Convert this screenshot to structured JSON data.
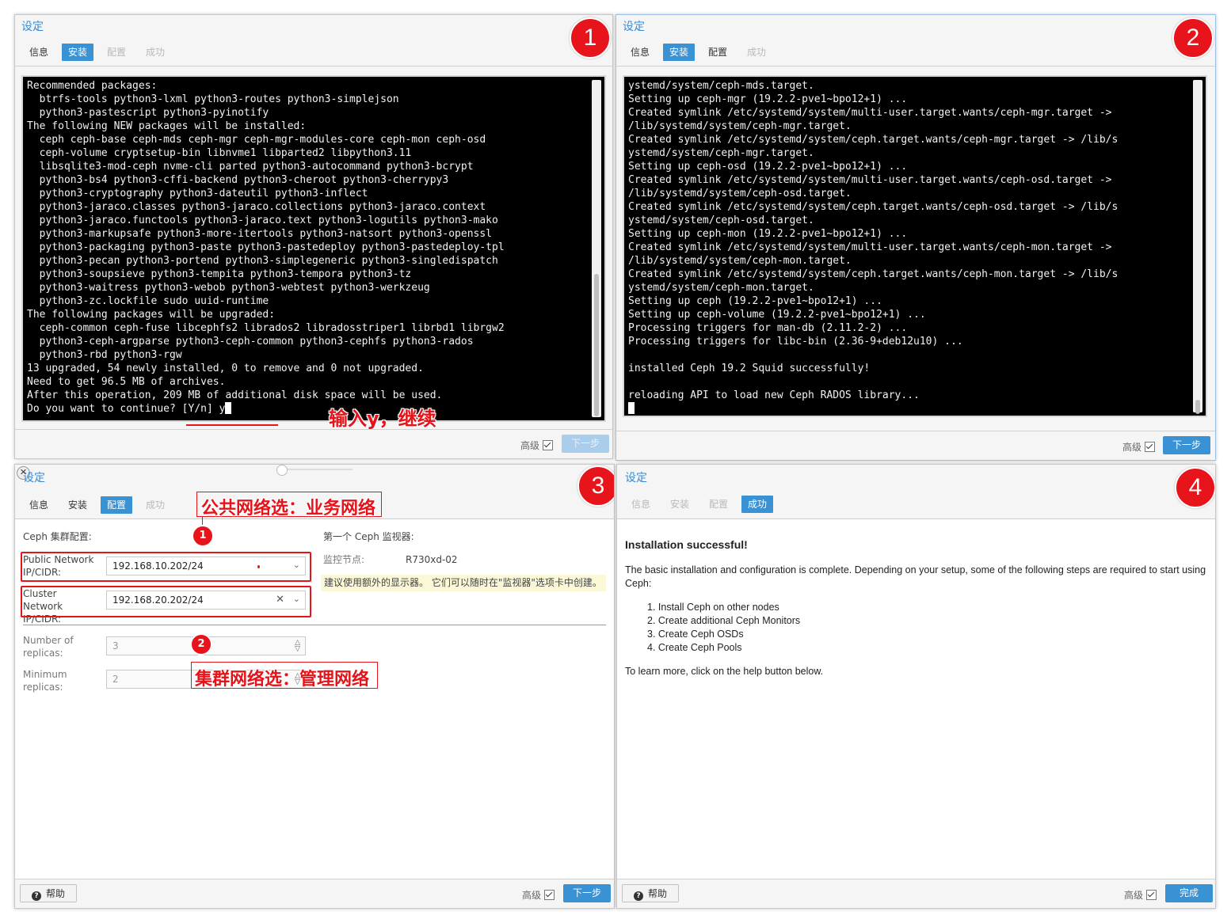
{
  "common": {
    "title": "设定",
    "tabs": [
      "信息",
      "安装",
      "配置",
      "成功"
    ],
    "advanced_label": "高级",
    "next_label": "下一步",
    "finish_label": "完成",
    "help_label": "帮助"
  },
  "badges": [
    "1",
    "2",
    "3",
    "4"
  ],
  "panel1": {
    "terminal_lines": [
      "Recommended packages:",
      "  btrfs-tools python3-lxml python3-routes python3-simplejson",
      "  python3-pastescript python3-pyinotify",
      "The following NEW packages will be installed:",
      "  ceph ceph-base ceph-mds ceph-mgr ceph-mgr-modules-core ceph-mon ceph-osd",
      "  ceph-volume cryptsetup-bin libnvme1 libparted2 libpython3.11",
      "  libsqlite3-mod-ceph nvme-cli parted python3-autocommand python3-bcrypt",
      "  python3-bs4 python3-cffi-backend python3-cheroot python3-cherrypy3",
      "  python3-cryptography python3-dateutil python3-inflect",
      "  python3-jaraco.classes python3-jaraco.collections python3-jaraco.context",
      "  python3-jaraco.functools python3-jaraco.text python3-logutils python3-mako",
      "  python3-markupsafe python3-more-itertools python3-natsort python3-openssl",
      "  python3-packaging python3-paste python3-pastedeploy python3-pastedeploy-tpl",
      "  python3-pecan python3-portend python3-simplegeneric python3-singledispatch",
      "  python3-soupsieve python3-tempita python3-tempora python3-tz",
      "  python3-waitress python3-webob python3-webtest python3-werkzeug",
      "  python3-zc.lockfile sudo uuid-runtime",
      "The following packages will be upgraded:",
      "  ceph-common ceph-fuse libcephfs2 librados2 libradosstriper1 librbd1 librgw2",
      "  python3-ceph-argparse python3-ceph-common python3-cephfs python3-rados",
      "  python3-rbd python3-rgw",
      "13 upgraded, 54 newly installed, 0 to remove and 0 not upgraded.",
      "Need to get 96.5 MB of archives.",
      "After this operation, 209 MB of additional disk space will be used."
    ],
    "prompt": "Do you want to continue? [Y/n] y",
    "annotation": "输入y，继续"
  },
  "panel2": {
    "terminal_lines": [
      "ystemd/system/ceph-mds.target.",
      "Setting up ceph-mgr (19.2.2-pve1~bpo12+1) ...",
      "Created symlink /etc/systemd/system/multi-user.target.wants/ceph-mgr.target ->",
      "/lib/systemd/system/ceph-mgr.target.",
      "Created symlink /etc/systemd/system/ceph.target.wants/ceph-mgr.target -> /lib/s",
      "ystemd/system/ceph-mgr.target.",
      "Setting up ceph-osd (19.2.2-pve1~bpo12+1) ...",
      "Created symlink /etc/systemd/system/multi-user.target.wants/ceph-osd.target ->",
      "/lib/systemd/system/ceph-osd.target.",
      "Created symlink /etc/systemd/system/ceph.target.wants/ceph-osd.target -> /lib/s",
      "ystemd/system/ceph-osd.target.",
      "Setting up ceph-mon (19.2.2-pve1~bpo12+1) ...",
      "Created symlink /etc/systemd/system/multi-user.target.wants/ceph-mon.target ->",
      "/lib/systemd/system/ceph-mon.target.",
      "Created symlink /etc/systemd/system/ceph.target.wants/ceph-mon.target -> /lib/s",
      "ystemd/system/ceph-mon.target.",
      "Setting up ceph (19.2.2-pve1~bpo12+1) ...",
      "Setting up ceph-volume (19.2.2-pve1~bpo12+1) ...",
      "Processing triggers for man-db (2.11.2-2) ...",
      "Processing triggers for libc-bin (2.36-9+deb12u10) ...",
      "",
      "installed Ceph 19.2 Squid successfully!",
      "",
      "reloading API to load new Ceph RADOS library..."
    ]
  },
  "panel3": {
    "annotation_public": "公共网络选：业务网络",
    "annotation_cluster": "集群网络选：管理网络",
    "mini_badges": [
      "1",
      "2"
    ],
    "cluster_config_label": "Ceph 集群配置:",
    "public_network_label": "Public Network IP/CIDR:",
    "public_network_value": "192.168.10.202/24",
    "cluster_network_label": "Cluster Network IP/CIDR:",
    "cluster_network_value": "192.168.20.202/24",
    "replicas_label": "Number of replicas:",
    "replicas_value": "3",
    "min_replicas_label": "Minimum replicas:",
    "min_replicas_value": "2",
    "first_monitor_label": "第一个 Ceph 监视器:",
    "monitor_node_label": "监控节点:",
    "monitor_node_value": "R730xd-02",
    "monitor_note": "建议使用额外的显示器。 它们可以随时在\"监视器\"选项卡中创建。"
  },
  "panel4": {
    "heading": "Installation successful!",
    "intro": "The basic installation and configuration is complete. Depending on your setup, some of the following steps are required to start using Ceph:",
    "steps": [
      "1. Install Ceph on other nodes",
      "2. Create additional Ceph Monitors",
      "3. Create Ceph OSDs",
      "4. Create Ceph Pools"
    ],
    "outro": "To learn more, click on the help button below."
  }
}
